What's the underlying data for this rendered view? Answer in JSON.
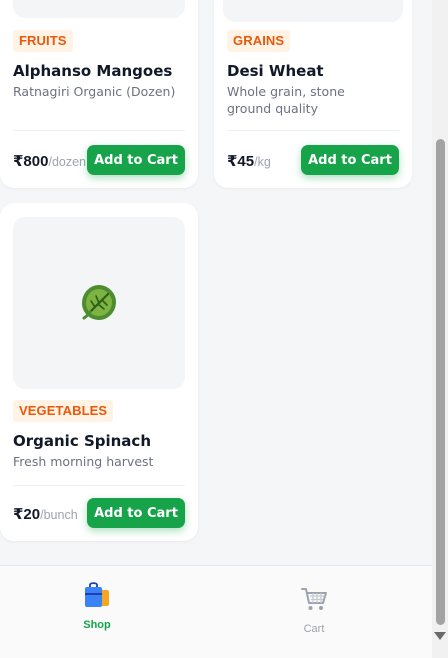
{
  "products": [
    {
      "category": "FRUITS",
      "name": "Alphanso Mangoes",
      "description": "Ratnagiri Organic (Dozen)",
      "price": "₹800",
      "unit": "/dozen",
      "button": "Add to Cart"
    },
    {
      "category": "GRAINS",
      "name": "Desi Wheat",
      "description": "Whole grain, stone ground quality",
      "price": "₹45",
      "unit": "/kg",
      "button": "Add to Cart"
    },
    {
      "category": "VEGETABLES",
      "name": "Organic Spinach",
      "description": "Fresh morning harvest",
      "price": "₹20",
      "unit": "/bunch",
      "button": "Add to Cart",
      "icon": "leafy-green-icon"
    }
  ],
  "nav": {
    "shop": {
      "label": "Shop",
      "icon": "shopping-bags-icon",
      "active": true,
      "color": "#16a34a"
    },
    "cart": {
      "label": "Cart",
      "icon": "shopping-cart-icon",
      "active": false,
      "color": "#9ca3af"
    }
  },
  "colors": {
    "accent": "#16a34a",
    "badge_text": "#e8590c",
    "badge_bg": "#fff3e6"
  }
}
